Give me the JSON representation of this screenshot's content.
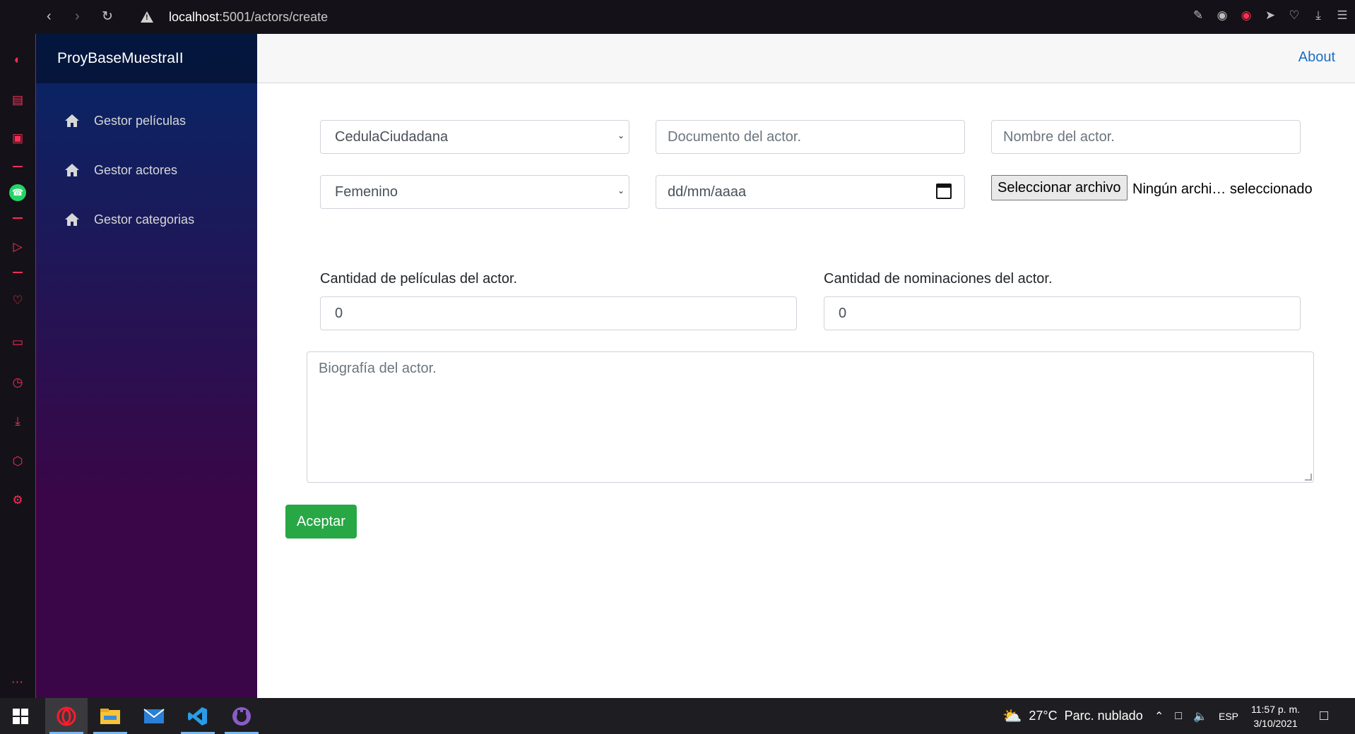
{
  "browser": {
    "url_host": "localhost",
    "url_path": ":5001/actors/create"
  },
  "app": {
    "brand": "ProyBaseMuestraII",
    "nav": [
      {
        "label": "Gestor películas"
      },
      {
        "label": "Gestor actores"
      },
      {
        "label": "Gestor categorias"
      }
    ],
    "about_link": "About"
  },
  "form": {
    "doc_type_selected": "CedulaCiudadana",
    "document_placeholder": "Documento del actor.",
    "name_placeholder": "Nombre del actor.",
    "gender_selected": "Femenino",
    "date_placeholder": "dd/mm/aaaa",
    "file_button": "Seleccionar archivo",
    "file_status": "Ningún archi… seleccionado",
    "movies_count_label": "Cantidad de películas del actor.",
    "movies_count_value": "0",
    "nominations_label": "Cantidad de nominaciones del actor.",
    "nominations_value": "0",
    "biography_placeholder": "Biografía del actor.",
    "submit_label": "Aceptar"
  },
  "taskbar": {
    "weather_temp": "27°C",
    "weather_text": "Parc. nublado",
    "language": "ESP",
    "time": "11:57 p. m.",
    "date": "3/10/2021"
  }
}
